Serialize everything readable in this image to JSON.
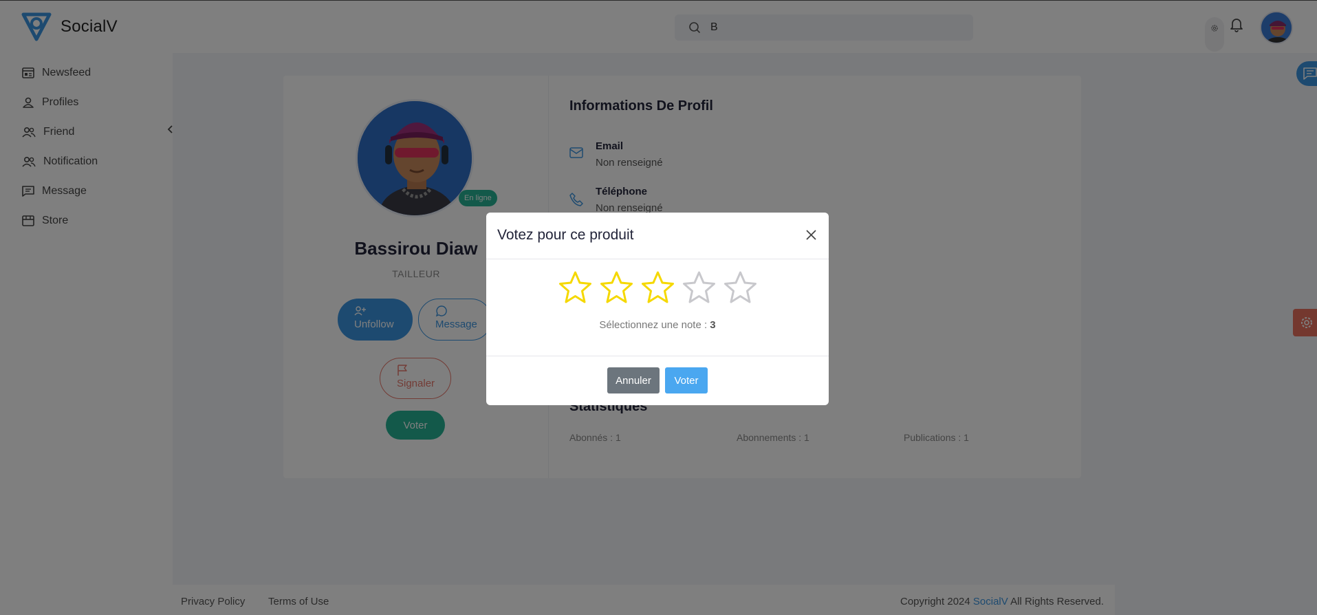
{
  "app": {
    "name": "SocialV"
  },
  "search": {
    "value": "B"
  },
  "sidebar": {
    "items": [
      {
        "label": "Newsfeed",
        "icon": "newsfeed-icon"
      },
      {
        "label": "Profiles",
        "icon": "user-icon"
      },
      {
        "label": "Friend",
        "icon": "friends-icon"
      },
      {
        "label": "Notification",
        "icon": "notification-users-icon"
      },
      {
        "label": "Message",
        "icon": "message-icon"
      },
      {
        "label": "Store",
        "icon": "store-icon"
      }
    ]
  },
  "profile": {
    "name": "Bassirou Diaw",
    "role": "TAILLEUR",
    "status": "En ligne",
    "buttons": {
      "unfollow": "Unfollow",
      "message": "Message",
      "signaler": "Signaler",
      "voter": "Voter"
    }
  },
  "info": {
    "title": "Informations De Profil",
    "email_label": "Email",
    "email_value": "Non renseigné",
    "phone_label": "Téléphone",
    "phone_value": "Non renseigné"
  },
  "stats": {
    "title": "Statistiques",
    "abonnes": "Abonnés : 1",
    "abonnements": "Abonnements : 1",
    "publications": "Publications : 1"
  },
  "footer": {
    "privacy": "Privacy Policy",
    "terms": "Terms of Use",
    "copyright_prefix": "Copyright 2024 ",
    "copyright_brand": "SocialV",
    "copyright_suffix": " All Rights Reserved."
  },
  "modal": {
    "title": "Votez pour ce produit",
    "rating": 3,
    "max_rating": 5,
    "note_prefix": "Sélectionnez une note : ",
    "note_value": "3",
    "cancel_label": "Annuler",
    "submit_label": "Voter"
  },
  "colors": {
    "accent": "#3b95e0",
    "success": "#27b395",
    "danger": "#e6776a",
    "star_active": "#f5d800",
    "star_inactive": "#c8c8cc"
  }
}
